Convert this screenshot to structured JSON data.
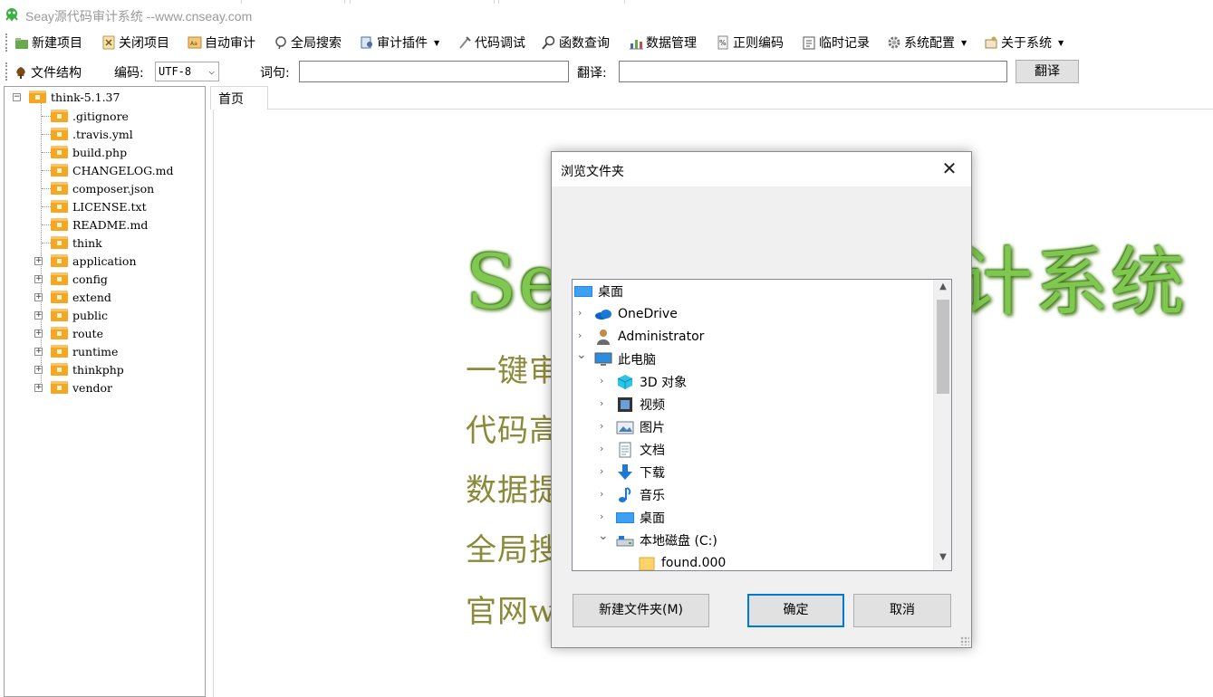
{
  "window": {
    "title": "Seay源代码审计系统  --www.cnseay.com"
  },
  "toolbar": {
    "items": [
      {
        "label": "新建项目",
        "icon": "new-project-icon",
        "dropdown": false
      },
      {
        "label": "关闭项目",
        "icon": "close-project-icon",
        "dropdown": false
      },
      {
        "label": "自动审计",
        "icon": "auto-audit-icon",
        "dropdown": false
      },
      {
        "label": "全局搜索",
        "icon": "global-search-icon",
        "dropdown": false
      },
      {
        "label": "审计插件",
        "icon": "plugin-icon",
        "dropdown": true
      },
      {
        "label": "代码调试",
        "icon": "debug-icon",
        "dropdown": false
      },
      {
        "label": "函数查询",
        "icon": "function-search-icon",
        "dropdown": false
      },
      {
        "label": "数据管理",
        "icon": "data-management-icon",
        "dropdown": false
      },
      {
        "label": "正则编码",
        "icon": "regex-icon",
        "dropdown": false
      },
      {
        "label": "临时记录",
        "icon": "notes-icon",
        "dropdown": false
      },
      {
        "label": "系统配置",
        "icon": "gear-icon",
        "dropdown": true
      },
      {
        "label": "关于系统",
        "icon": "about-icon",
        "dropdown": true
      }
    ]
  },
  "toolbar2": {
    "file_structure_label": "文件结构",
    "encoding_label": "编码:",
    "encoding_value": "UTF-8",
    "word_label": "词句:",
    "word_value": "",
    "translate_label": "翻译:",
    "translate_value": "",
    "translate_button": "翻译"
  },
  "tree": {
    "root": "think-5.1.37",
    "files": [
      ".gitignore",
      ".travis.yml",
      "build.php",
      "CHANGELOG.md",
      "composer.json",
      "LICENSE.txt",
      "README.md",
      "think"
    ],
    "folders": [
      "application",
      "config",
      "extend",
      "public",
      "route",
      "runtime",
      "thinkphp",
      "vendor"
    ]
  },
  "main": {
    "tab_label": "首页",
    "hero_text": "Seay源代码审计系统",
    "features": [
      "一键审计  代码插件扩展  规则配置",
      "代码高亮  正则调试  编码转换",
      "数据提交  中英双互译  黑盒审计",
      "全局搜索  数据库管理和监控",
      "官网www.cnseay.com  团队出品"
    ]
  },
  "dialog": {
    "title": "浏览文件夹",
    "close_symbol": "✕",
    "items": [
      {
        "label": "桌面",
        "level": 0,
        "chevron": "",
        "icon": "desktop-icon"
      },
      {
        "label": "OneDrive",
        "level": 1,
        "chevron": "›",
        "icon": "onedrive-icon"
      },
      {
        "label": "Administrator",
        "level": 1,
        "chevron": "›",
        "icon": "user-icon"
      },
      {
        "label": "此电脑",
        "level": 1,
        "chevron": "⌄",
        "icon": "computer-icon"
      },
      {
        "label": "3D 对象",
        "level": 2,
        "chevron": "›",
        "icon": "3d-objects-icon"
      },
      {
        "label": "视频",
        "level": 2,
        "chevron": "›",
        "icon": "videos-icon"
      },
      {
        "label": "图片",
        "level": 2,
        "chevron": "›",
        "icon": "pictures-icon"
      },
      {
        "label": "文档",
        "level": 2,
        "chevron": "›",
        "icon": "documents-icon"
      },
      {
        "label": "下载",
        "level": 2,
        "chevron": "›",
        "icon": "downloads-icon"
      },
      {
        "label": "音乐",
        "level": 2,
        "chevron": "›",
        "icon": "music-icon"
      },
      {
        "label": "桌面",
        "level": 2,
        "chevron": "›",
        "icon": "desktop-icon"
      },
      {
        "label": "本地磁盘 (C:)",
        "level": 2,
        "chevron": "⌄",
        "icon": "drive-icon"
      },
      {
        "label": "found.000",
        "level": 3,
        "chevron": "",
        "icon": "folder-icon"
      }
    ],
    "buttons": {
      "new_folder": "新建文件夹(M)",
      "ok": "确定",
      "cancel": "取消"
    }
  },
  "colors": {
    "hero": "#7ec850",
    "feature_text": "#8b8a3a",
    "dialog_accent": "#0078d7"
  }
}
